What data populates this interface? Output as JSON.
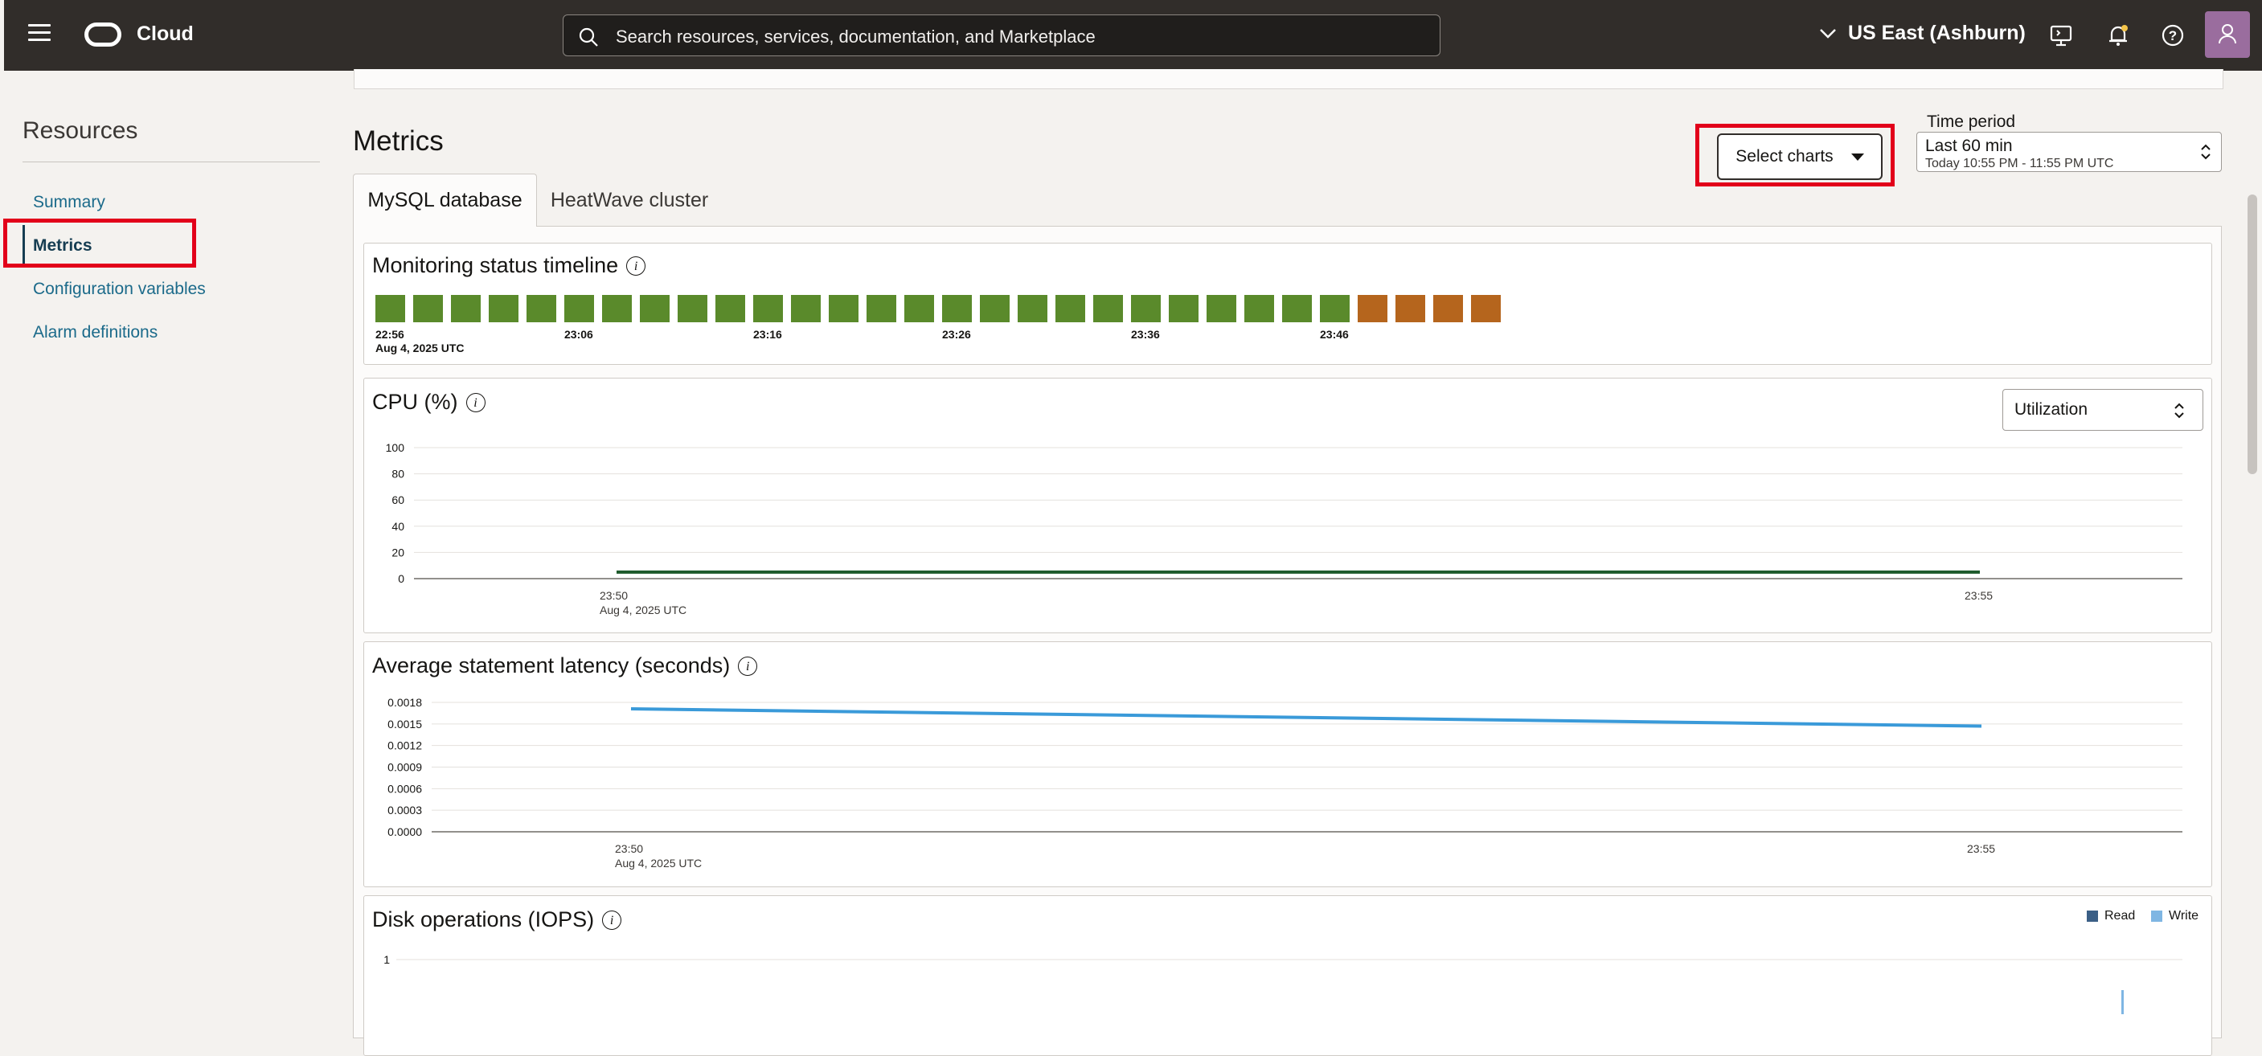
{
  "topbar": {
    "brand": "Cloud",
    "search_placeholder": "Search resources, services, documentation, and Marketplace",
    "region": "US East (Ashburn)"
  },
  "sidebar": {
    "title": "Resources",
    "items": [
      {
        "label": "Summary"
      },
      {
        "label": "Metrics"
      },
      {
        "label": "Configuration variables"
      },
      {
        "label": "Alarm definitions"
      }
    ]
  },
  "main": {
    "title": "Metrics",
    "select_charts_label": "Select charts",
    "time_period": {
      "label": "Time period",
      "value": "Last 60 min",
      "range": "Today 10:55 PM - 11:55 PM UTC"
    },
    "tabs": [
      {
        "label": "MySQL database"
      },
      {
        "label": "HeatWave cluster"
      }
    ],
    "timeline": {
      "title": "Monitoring status timeline",
      "tick_labels": [
        "22:56",
        "23:06",
        "23:16",
        "23:26",
        "23:36",
        "23:46"
      ],
      "date_label": "Aug 4, 2025 UTC",
      "statuses": [
        "ok",
        "ok",
        "ok",
        "ok",
        "ok",
        "ok",
        "ok",
        "ok",
        "ok",
        "ok",
        "ok",
        "ok",
        "ok",
        "ok",
        "ok",
        "ok",
        "ok",
        "ok",
        "ok",
        "ok",
        "ok",
        "ok",
        "ok",
        "ok",
        "ok",
        "ok",
        "warn",
        "warn",
        "warn",
        "warn"
      ],
      "colors": {
        "ok": "#5a8a2b",
        "warn": "#b5651d"
      }
    },
    "cpu_dropdown_value": "Utilization"
  },
  "chart_data": [
    {
      "type": "line",
      "title": "CPU (%)",
      "x": [
        "23:50",
        "23:55"
      ],
      "x_date_label": "Aug 4, 2025 UTC",
      "y_ticks": [
        "100",
        "80",
        "60",
        "40",
        "20",
        "0"
      ],
      "ylim": [
        0,
        100
      ],
      "series": [
        {
          "values": [
            5,
            5
          ],
          "color": "#1d5a2b"
        }
      ]
    },
    {
      "type": "line",
      "title": "Average statement latency (seconds)",
      "x": [
        "23:50",
        "23:55"
      ],
      "x_date_label": "Aug 4, 2025 UTC",
      "y_ticks": [
        "0.0018",
        "0.0015",
        "0.0012",
        "0.0009",
        "0.0006",
        "0.0003",
        "0.0000"
      ],
      "ylim": [
        0,
        0.0018
      ],
      "series": [
        {
          "values": [
            0.00171,
            0.00147
          ],
          "color": "#3a9ad9"
        }
      ]
    },
    {
      "type": "bar",
      "title": "Disk operations (IOPS)",
      "y_ticks": [
        "1"
      ],
      "legend": [
        {
          "name": "Read",
          "color": "#3b5f86"
        },
        {
          "name": "Write",
          "color": "#7fb6e3"
        }
      ]
    }
  ]
}
